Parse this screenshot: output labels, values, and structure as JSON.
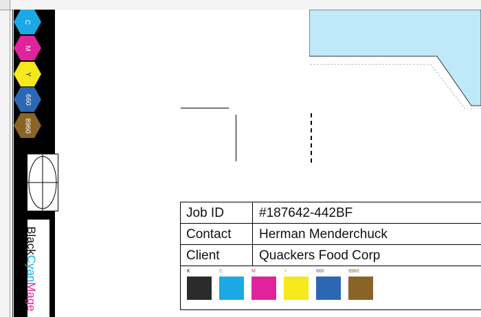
{
  "left_strip": {
    "chips": [
      {
        "label": "C",
        "color": "#1ba9e6"
      },
      {
        "label": "M",
        "color": "#e0239a"
      },
      {
        "label": "Y",
        "color": "#f5e81b"
      },
      {
        "label": "660",
        "color": "#2b67b3"
      },
      {
        "label": "8960",
        "color": "#8a6426"
      }
    ],
    "brand_parts": [
      "Black",
      "Cyan",
      "Mage"
    ],
    "brand_colors": [
      "#111111",
      "#1ba9e6",
      "#e0239a"
    ]
  },
  "info_table": {
    "rows": [
      {
        "label": "Job ID",
        "value": "#187642-442BF"
      },
      {
        "label": "Contact",
        "value": "Herman Menderchuck"
      },
      {
        "label": "Client",
        "value": "Quackers Food Corp"
      }
    ]
  },
  "swatches": [
    {
      "label": "K",
      "color": "#2b2b2b",
      "label_color": "#111111"
    },
    {
      "label": "C",
      "color": "#1ba9e6",
      "label_color": "#1ba9e6"
    },
    {
      "label": "M",
      "color": "#e0239a",
      "label_color": "#e0239a"
    },
    {
      "label": "Y",
      "color": "#f5e81b",
      "label_color": "#d4c900"
    },
    {
      "label": "660",
      "color": "#2b67b3",
      "label_color": "#2b67b3"
    },
    {
      "label": "8960",
      "color": "#8a6426",
      "label_color": "#8a6426"
    }
  ]
}
